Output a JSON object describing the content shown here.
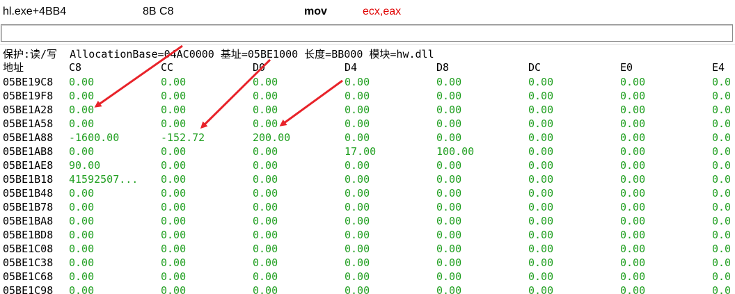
{
  "instruction": {
    "address": "hl.exe+4BB4",
    "bytes": "8B C8",
    "mnemonic": "mov",
    "operands": "ecx,eax"
  },
  "command_input": {
    "value": ""
  },
  "region_info": "保护:读/写  AllocationBase=04AC0000 基址=05BE1000 长度=BB000 模块=hw.dll",
  "dump": {
    "address_header": "地址",
    "columns": [
      "C8",
      "CC",
      "D0",
      "D4",
      "D8",
      "DC",
      "E0",
      "E4"
    ],
    "rows": [
      {
        "addr": "05BE19C8",
        "values": [
          "0.00",
          "0.00",
          "0.00",
          "0.00",
          "0.00",
          "0.00",
          "0.00",
          "0.0"
        ]
      },
      {
        "addr": "05BE19F8",
        "values": [
          "0.00",
          "0.00",
          "0.00",
          "0.00",
          "0.00",
          "0.00",
          "0.00",
          "0.0"
        ]
      },
      {
        "addr": "05BE1A28",
        "values": [
          "0.00",
          "0.00",
          "0.00",
          "0.00",
          "0.00",
          "0.00",
          "0.00",
          "0.0"
        ]
      },
      {
        "addr": "05BE1A58",
        "values": [
          "0.00",
          "0.00",
          "0.00",
          "0.00",
          "0.00",
          "0.00",
          "0.00",
          "0.0"
        ]
      },
      {
        "addr": "05BE1A88",
        "values": [
          "-1600.00",
          "-152.72",
          "200.00",
          "0.00",
          "0.00",
          "0.00",
          "0.00",
          "0.0"
        ]
      },
      {
        "addr": "05BE1AB8",
        "values": [
          "0.00",
          "0.00",
          "0.00",
          "17.00",
          "100.00",
          "0.00",
          "0.00",
          "0.0"
        ]
      },
      {
        "addr": "05BE1AE8",
        "values": [
          "90.00",
          "0.00",
          "0.00",
          "0.00",
          "0.00",
          "0.00",
          "0.00",
          "0.0"
        ]
      },
      {
        "addr": "05BE1B18",
        "values": [
          "41592507...",
          "0.00",
          "0.00",
          "0.00",
          "0.00",
          "0.00",
          "0.00",
          "0.0"
        ]
      },
      {
        "addr": "05BE1B48",
        "values": [
          "0.00",
          "0.00",
          "0.00",
          "0.00",
          "0.00",
          "0.00",
          "0.00",
          "0.0"
        ]
      },
      {
        "addr": "05BE1B78",
        "values": [
          "0.00",
          "0.00",
          "0.00",
          "0.00",
          "0.00",
          "0.00",
          "0.00",
          "0.0"
        ]
      },
      {
        "addr": "05BE1BA8",
        "values": [
          "0.00",
          "0.00",
          "0.00",
          "0.00",
          "0.00",
          "0.00",
          "0.00",
          "0.0"
        ]
      },
      {
        "addr": "05BE1BD8",
        "values": [
          "0.00",
          "0.00",
          "0.00",
          "0.00",
          "0.00",
          "0.00",
          "0.00",
          "0.0"
        ]
      },
      {
        "addr": "05BE1C08",
        "values": [
          "0.00",
          "0.00",
          "0.00",
          "0.00",
          "0.00",
          "0.00",
          "0.00",
          "0.0"
        ]
      },
      {
        "addr": "05BE1C38",
        "values": [
          "0.00",
          "0.00",
          "0.00",
          "0.00",
          "0.00",
          "0.00",
          "0.00",
          "0.0"
        ]
      },
      {
        "addr": "05BE1C68",
        "values": [
          "0.00",
          "0.00",
          "0.00",
          "0.00",
          "0.00",
          "0.00",
          "0.00",
          "0.0"
        ]
      },
      {
        "addr": "05BE1C98",
        "values": [
          "0.00",
          "0.00",
          "0.00",
          "0.00",
          "0.00",
          "0.00",
          "0.00",
          "0.0"
        ]
      }
    ]
  },
  "colors": {
    "value_text": "#22a022",
    "operand_text": "#e00000",
    "annotation_arrow": "#e8232a"
  },
  "annotation_icon": "red-arrow-icon"
}
